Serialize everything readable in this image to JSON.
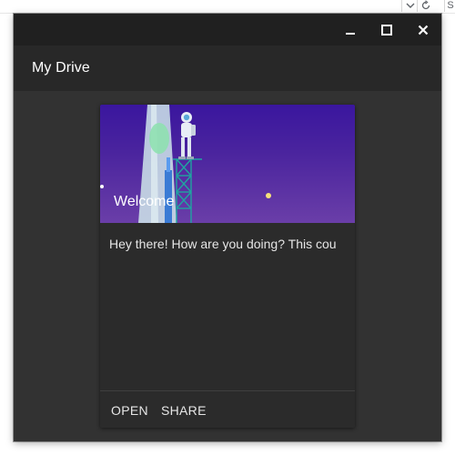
{
  "browser_chrome": {
    "dropdown_icon": "chevron-down-icon",
    "refresh_icon": "refresh-icon",
    "edge_label": "S"
  },
  "window": {
    "controls": [
      "minimize-icon",
      "maximize-icon",
      "close-icon"
    ],
    "app_title": "My Drive"
  },
  "card": {
    "title": "Welcome",
    "body_text": "Hey there! How are you doing? This cou",
    "actions": [
      "OPEN",
      "SHARE"
    ],
    "colors": {
      "media_top": "#3a169e",
      "media_bottom": "#6a3ea8",
      "card_bg": "#2b2b2b",
      "window_bg": "#323232"
    }
  }
}
